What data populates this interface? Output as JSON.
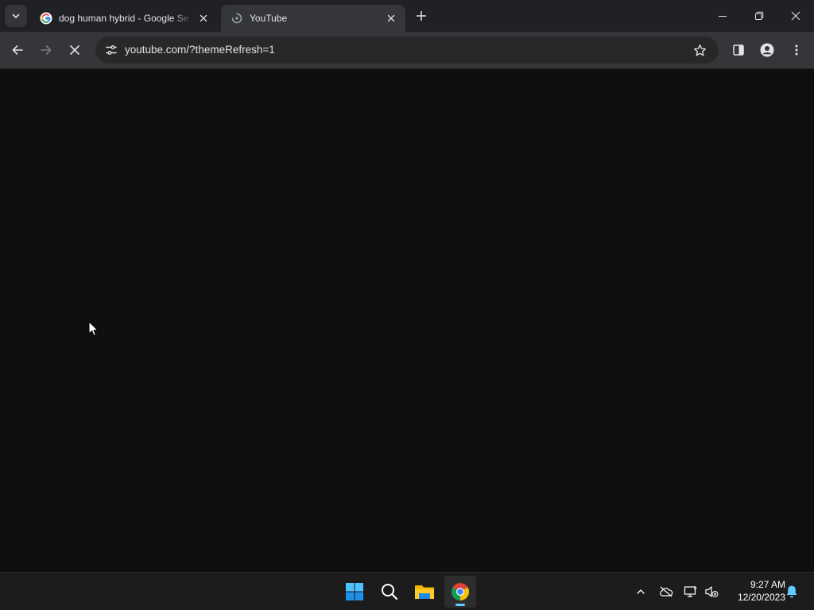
{
  "browser": {
    "tabs": [
      {
        "title": "dog human hybrid - Google Se",
        "favicon": "google-g-icon",
        "active": false
      },
      {
        "title": "YouTube",
        "favicon": "loading-icon",
        "active": true
      }
    ],
    "address_bar": {
      "url": "youtube.com/?themeRefresh=1"
    },
    "toolbar_icons": [
      "back-icon",
      "forward-icon",
      "stop-icon",
      "site-info-icon",
      "star-icon",
      "side-panel-icon",
      "profile-icon",
      "menu-icon"
    ],
    "window_controls": [
      "minimize-icon",
      "restore-icon",
      "close-icon"
    ]
  },
  "page": {
    "background": "#0f0f0f"
  },
  "taskbar": {
    "apps": [
      "windows-start-icon",
      "search-icon",
      "file-explorer-icon",
      "chrome-icon"
    ],
    "active_app": "chrome-icon",
    "tray": [
      "chevron-up-icon",
      "onedrive-offline-icon",
      "network-icon",
      "volume-muted-icon",
      "notification-bell-icon"
    ],
    "clock": {
      "time": "9:27 AM",
      "date": "12/20/2023"
    }
  },
  "colors": {
    "tabstrip": "#202124",
    "toolbar": "#35363a",
    "omnibox": "#282828",
    "taskbar": "#1c1c1c",
    "accent": "#60cdff"
  }
}
